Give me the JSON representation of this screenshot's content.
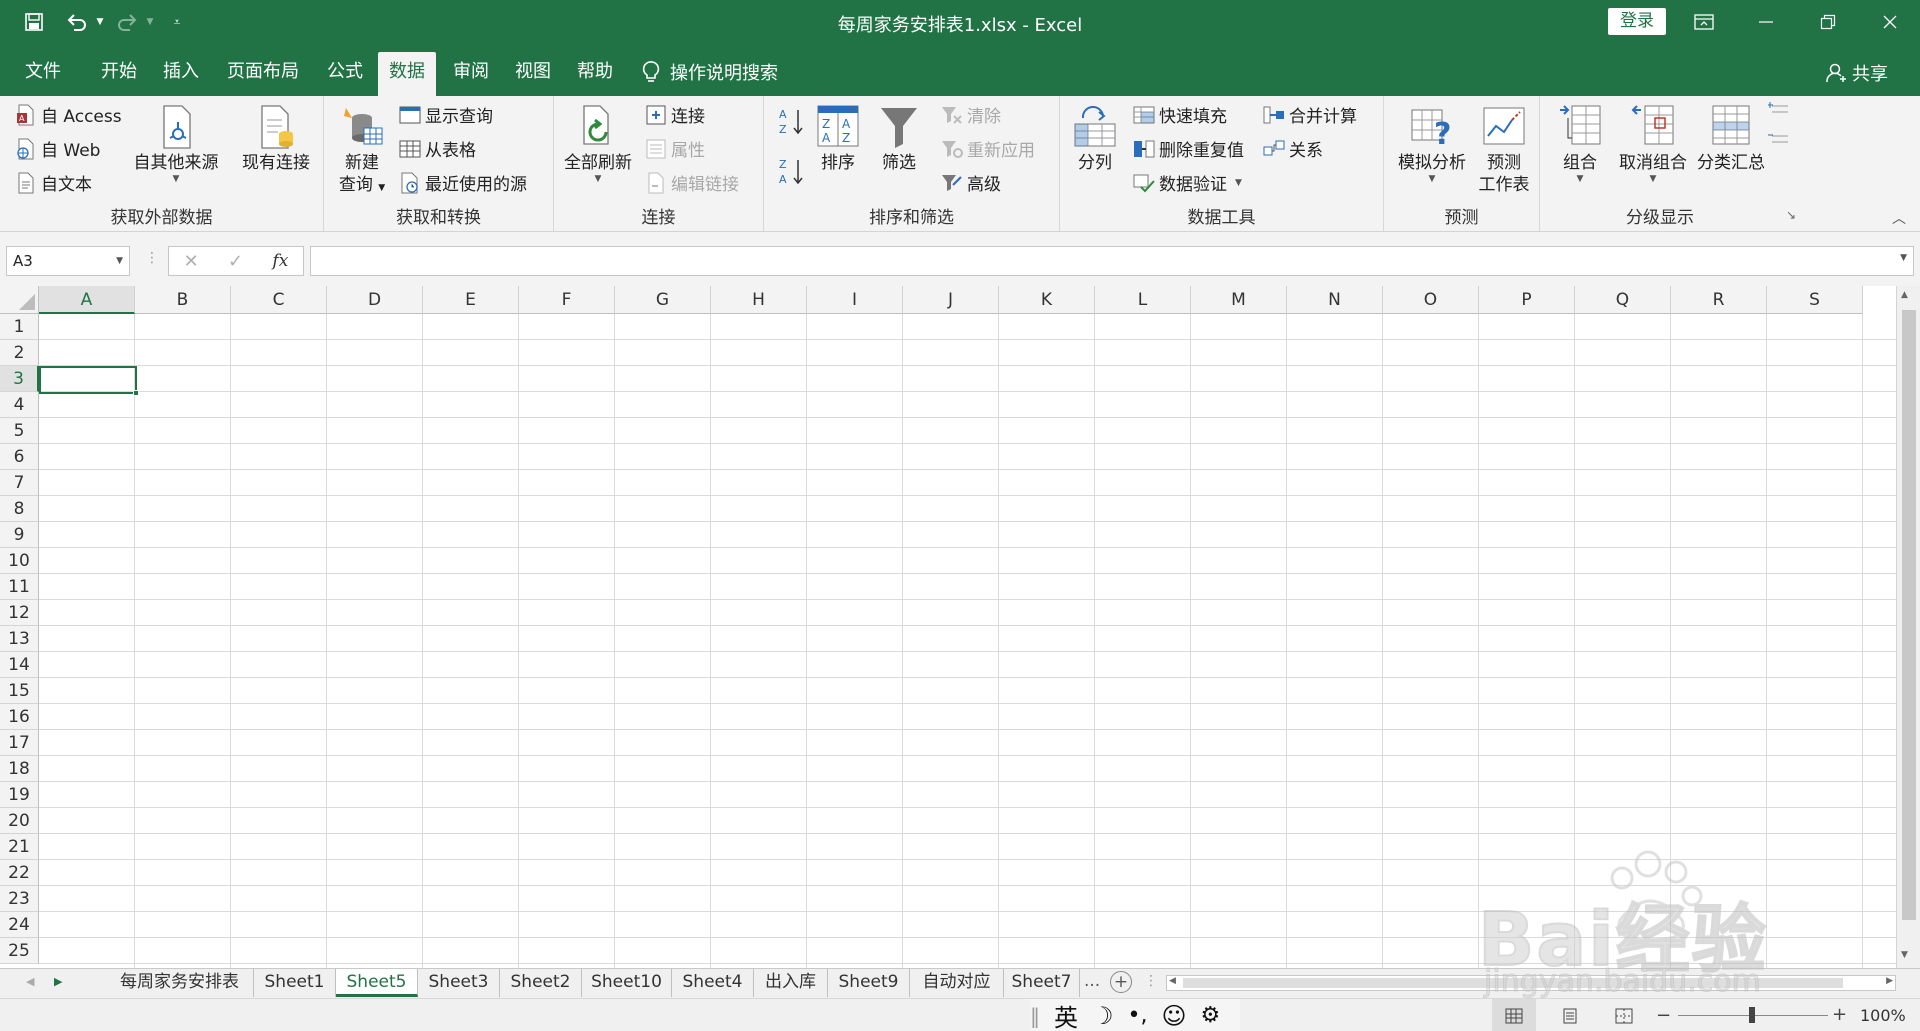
{
  "window": {
    "title": "每周家务安排表1.xlsx  -  Excel",
    "login": "登录"
  },
  "tabs": [
    "文件",
    "开始",
    "插入",
    "页面布局",
    "公式",
    "数据",
    "审阅",
    "视图",
    "帮助"
  ],
  "active_tab": "数据",
  "tell_me": "操作说明搜索",
  "share": "共享",
  "ribbon": {
    "get_external": {
      "label": "获取外部数据",
      "access": "自 Access",
      "web": "自 Web",
      "text": "自文本",
      "other": "自其他来源",
      "existing": "现有连接"
    },
    "get_transform": {
      "label": "获取和转换",
      "new_query_1": "新建",
      "new_query_2": "查询",
      "show_queries": "显示查询",
      "from_table": "从表格",
      "recent_sources": "最近使用的源"
    },
    "connections": {
      "label": "连接",
      "refresh_all": "全部刷新",
      "connections": "连接",
      "properties": "属性",
      "edit_links": "编辑链接"
    },
    "sort_filter": {
      "label": "排序和筛选",
      "sort": "排序",
      "filter": "筛选",
      "clear": "清除",
      "reapply": "重新应用",
      "advanced": "高级"
    },
    "data_tools": {
      "label": "数据工具",
      "text_to_columns": "分列",
      "flash_fill": "快速填充",
      "remove_duplicates": "删除重复值",
      "data_validation": "数据验证",
      "consolidate": "合并计算",
      "relationships": "关系"
    },
    "forecast": {
      "label": "预测",
      "what_if": "模拟分析",
      "forecast_sheet_1": "预测",
      "forecast_sheet_2": "工作表"
    },
    "outline": {
      "label": "分级显示",
      "group": "组合",
      "ungroup": "取消组合",
      "subtotal": "分类汇总"
    }
  },
  "formula_bar": {
    "name_box": "A3",
    "fx": "fx",
    "formula": ""
  },
  "grid": {
    "columns": [
      "A",
      "B",
      "C",
      "D",
      "E",
      "F",
      "G",
      "H",
      "I",
      "J",
      "K",
      "L",
      "M",
      "N",
      "O",
      "P",
      "Q",
      "R",
      "S"
    ],
    "rows": [
      "1",
      "2",
      "3",
      "4",
      "5",
      "6",
      "7",
      "8",
      "9",
      "10",
      "11",
      "12",
      "13",
      "14",
      "15",
      "16",
      "17",
      "18",
      "19",
      "20",
      "21",
      "22",
      "23",
      "24",
      "25"
    ],
    "selected_cell": "A3"
  },
  "sheets": [
    "每周家务安排表",
    "Sheet1",
    "Sheet5",
    "Sheet3",
    "Sheet2",
    "Sheet10",
    "Sheet4",
    "出入库",
    "Sheet9",
    "自动对应",
    "Sheet7"
  ],
  "active_sheet": "Sheet5",
  "more_sheets": "...",
  "ime": {
    "mode": "英"
  },
  "status": {
    "zoom": "100%"
  },
  "watermark": {
    "brand": "Bai经验",
    "url": "jingyan.baidu.com"
  },
  "colors": {
    "accent": "#217346",
    "ribbon_bg": "#f3f3f3"
  }
}
